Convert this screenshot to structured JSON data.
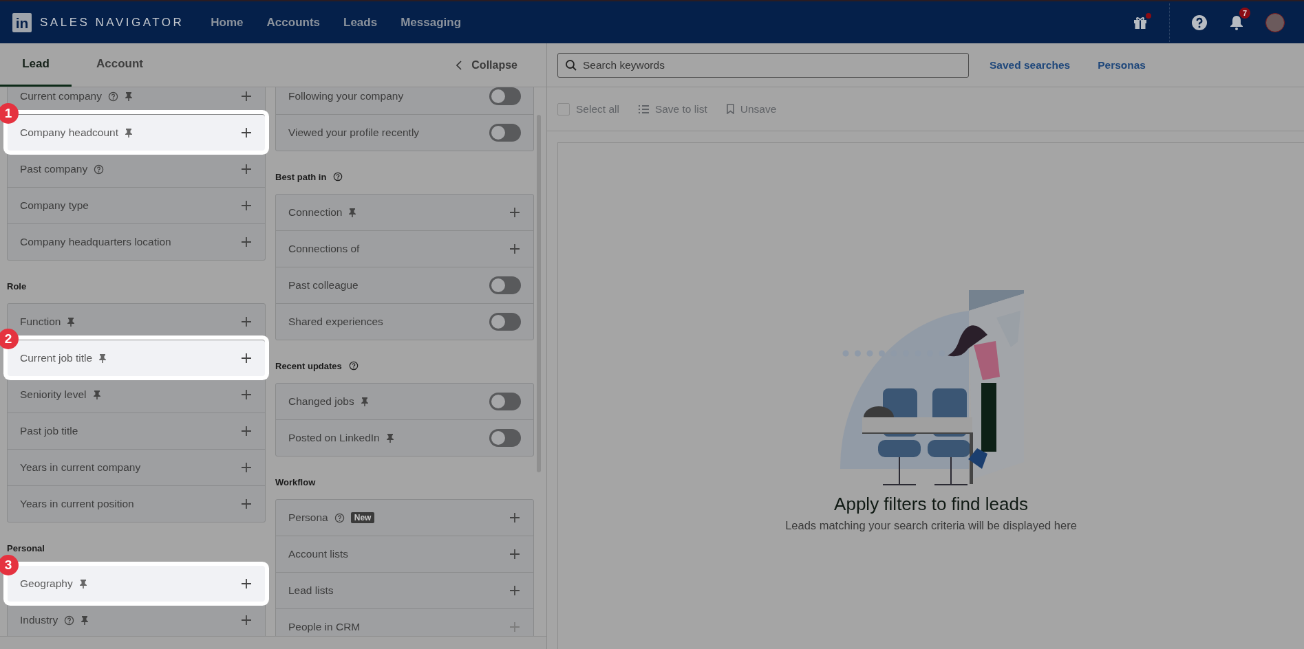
{
  "navbar": {
    "logo": "in",
    "brand": "SALES NAVIGATOR",
    "links": [
      {
        "label": "Home"
      },
      {
        "label": "Accounts"
      },
      {
        "label": "Leads"
      },
      {
        "label": "Messaging"
      }
    ],
    "icons": [
      {
        "kind": "gift",
        "dot": true
      },
      {
        "kind": "help",
        "dot": false
      },
      {
        "kind": "bell",
        "dot": false,
        "count": "7"
      },
      {
        "kind": "avatar",
        "dot": false
      }
    ]
  },
  "filter_tabs": [
    {
      "label": "Lead",
      "selected": true
    },
    {
      "label": "Account",
      "selected": false
    }
  ],
  "collapse": {
    "label": "Collapse"
  },
  "filter_columns": [
    [
      {
        "items": [
          {
            "label": "Current company",
            "help": true,
            "pinned": true,
            "kind": "plus",
            "disabled": false,
            "highlighted": false
          },
          {
            "label": "Company headcount",
            "help": false,
            "pinned": true,
            "kind": "plus",
            "disabled": false,
            "highlighted": true,
            "step": "1"
          },
          {
            "label": "Past company",
            "help": true,
            "pinned": false,
            "kind": "plus",
            "disabled": false,
            "highlighted": false
          },
          {
            "label": "Company type",
            "help": false,
            "pinned": false,
            "kind": "plus",
            "disabled": false,
            "highlighted": false
          },
          {
            "label": "Company headquarters location",
            "help": false,
            "pinned": false,
            "kind": "plus",
            "disabled": false,
            "highlighted": false
          }
        ]
      },
      {
        "heading": "Role",
        "help": false,
        "items": [
          {
            "label": "Function",
            "help": false,
            "pinned": true,
            "kind": "plus",
            "disabled": false,
            "highlighted": false
          },
          {
            "label": "Current job title",
            "help": false,
            "pinned": true,
            "kind": "plus",
            "disabled": false,
            "highlighted": true,
            "step": "2"
          },
          {
            "label": "Seniority level",
            "help": false,
            "pinned": true,
            "kind": "plus",
            "disabled": false,
            "highlighted": false
          },
          {
            "label": "Past job title",
            "help": false,
            "pinned": false,
            "kind": "plus",
            "disabled": false,
            "highlighted": false
          },
          {
            "label": "Years in current company",
            "help": false,
            "pinned": false,
            "kind": "plus",
            "disabled": false,
            "highlighted": false
          },
          {
            "label": "Years in current position",
            "help": false,
            "pinned": false,
            "kind": "plus",
            "disabled": false,
            "highlighted": false
          }
        ]
      },
      {
        "heading": "Personal",
        "help": false,
        "items": [
          {
            "label": "Geography",
            "help": false,
            "pinned": true,
            "kind": "plus",
            "disabled": false,
            "highlighted": true,
            "step": "3"
          },
          {
            "label": "Industry",
            "help": true,
            "pinned": true,
            "kind": "plus",
            "disabled": false,
            "highlighted": false
          }
        ]
      }
    ],
    [
      {
        "items": [
          {
            "label": "Following your company",
            "help": false,
            "pinned": false,
            "kind": "toggle",
            "on": false,
            "highlighted": false
          },
          {
            "label": "Viewed your profile recently",
            "help": false,
            "pinned": false,
            "kind": "toggle",
            "on": false,
            "highlighted": false
          }
        ]
      },
      {
        "heading": "Best path in",
        "help": true,
        "items": [
          {
            "label": "Connection",
            "help": false,
            "pinned": true,
            "kind": "plus",
            "disabled": false,
            "highlighted": false
          },
          {
            "label": "Connections of",
            "help": false,
            "pinned": false,
            "kind": "plus",
            "disabled": false,
            "highlighted": false
          },
          {
            "label": "Past colleague",
            "help": false,
            "pinned": false,
            "kind": "toggle",
            "on": false,
            "highlighted": false
          },
          {
            "label": "Shared experiences",
            "help": false,
            "pinned": false,
            "kind": "toggle",
            "on": false,
            "highlighted": false
          }
        ]
      },
      {
        "heading": "Recent updates",
        "help": true,
        "items": [
          {
            "label": "Changed jobs",
            "help": false,
            "pinned": true,
            "kind": "toggle",
            "on": false,
            "highlighted": false
          },
          {
            "label": "Posted on LinkedIn",
            "help": false,
            "pinned": true,
            "kind": "toggle",
            "on": false,
            "highlighted": false
          }
        ]
      },
      {
        "heading": "Workflow",
        "help": false,
        "items": [
          {
            "label": "Persona",
            "help": true,
            "pinned": false,
            "new_badge": "New",
            "kind": "plus",
            "disabled": false,
            "highlighted": false
          },
          {
            "label": "Account lists",
            "help": false,
            "pinned": false,
            "kind": "plus",
            "disabled": false,
            "highlighted": false
          },
          {
            "label": "Lead lists",
            "help": false,
            "pinned": false,
            "kind": "plus",
            "disabled": false,
            "highlighted": false
          },
          {
            "label": "People in CRM",
            "help": false,
            "pinned": false,
            "kind": "plus",
            "disabled": true,
            "highlighted": false
          }
        ]
      }
    ]
  ],
  "search": {
    "placeholder": "Search keywords"
  },
  "header_links": [
    {
      "label": "Saved searches"
    },
    {
      "label": "Personas"
    }
  ],
  "results_toolbar": {
    "select_all": {
      "label": "Select all",
      "checked": false,
      "disabled": true
    },
    "actions": [
      {
        "kind": "list",
        "label": "Save to list",
        "disabled": true
      },
      {
        "kind": "bookmark",
        "label": "Unsave",
        "disabled": true
      }
    ]
  },
  "empty_state": {
    "title": "Apply filters to find leads",
    "subtitle": "Leads matching your search criteria will be displayed here"
  }
}
